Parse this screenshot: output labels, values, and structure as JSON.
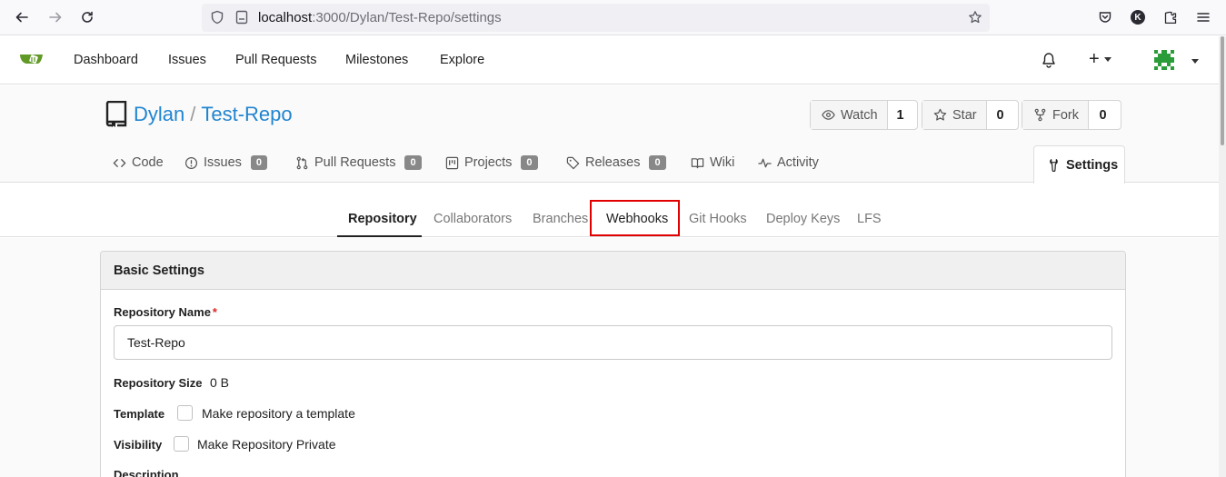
{
  "browser": {
    "url_host": "localhost",
    "url_rest": ":3000/Dylan/Test-Repo/settings",
    "account_initial": "K"
  },
  "topnav": {
    "items": [
      "Dashboard",
      "Issues",
      "Pull Requests",
      "Milestones",
      "Explore"
    ],
    "plus": "+"
  },
  "repo": {
    "owner": "Dylan",
    "separator": "/",
    "name": "Test-Repo",
    "watch_label": "Watch",
    "watch_count": "1",
    "star_label": "Star",
    "star_count": "0",
    "fork_label": "Fork",
    "fork_count": "0",
    "tabs": {
      "code": "Code",
      "issues": "Issues",
      "issues_count": "0",
      "pulls": "Pull Requests",
      "pulls_count": "0",
      "projects": "Projects",
      "projects_count": "0",
      "releases": "Releases",
      "releases_count": "0",
      "wiki": "Wiki",
      "activity": "Activity",
      "settings": "Settings"
    }
  },
  "settings_tabs": [
    "Repository",
    "Collaborators",
    "Branches",
    "Webhooks",
    "Git Hooks",
    "Deploy Keys",
    "LFS"
  ],
  "basic_settings": {
    "title": "Basic Settings",
    "name_label": "Repository Name",
    "required_mark": "*",
    "name_value": "Test-Repo",
    "size_label": "Repository Size",
    "size_value": "0 B",
    "template_label": "Template",
    "template_check": "Make repository a template",
    "visibility_label": "Visibility",
    "visibility_check": "Make Repository Private",
    "description_label": "Description"
  }
}
